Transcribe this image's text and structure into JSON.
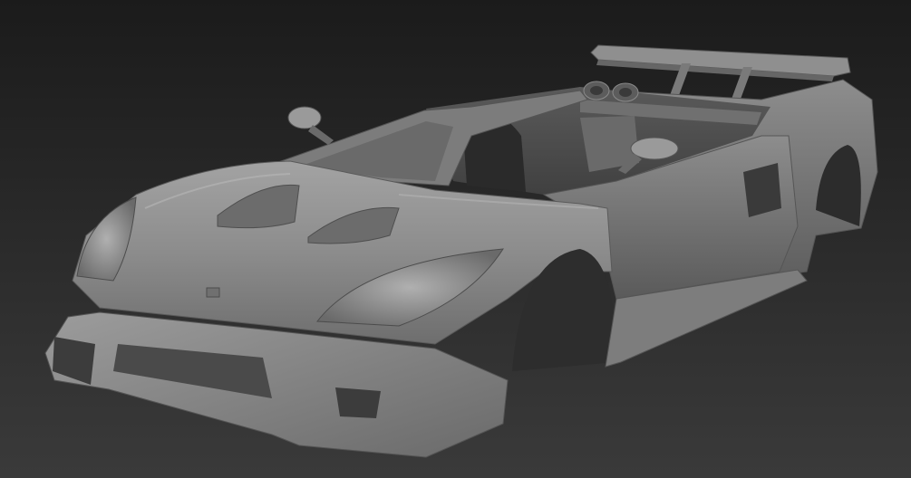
{
  "scene": {
    "subject": "car-body-3d-model",
    "render_style": "grey-clay-shaded",
    "background": {
      "top": "#1b1b1b",
      "bottom": "#3a3a3a"
    },
    "model_color": "#8a8a8a",
    "highlight_color": "#bdbdbd",
    "shadow_color": "#3c3c3c"
  }
}
